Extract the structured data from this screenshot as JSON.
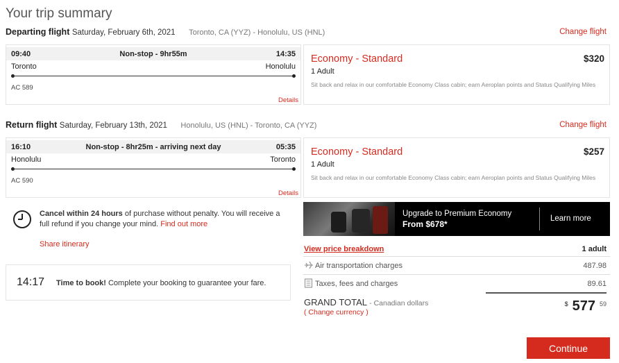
{
  "page": {
    "title": "Your trip summary"
  },
  "departing": {
    "label": "Departing flight",
    "date": "Saturday, February 6th, 2021",
    "route": "Toronto, CA (YYZ) - Honolulu, US (HNL)",
    "change_link": "Change flight",
    "dep_time": "09:40",
    "stops": "Non-stop - 9hr55m",
    "arr_time": "14:35",
    "origin": "Toronto",
    "destination": "Honolulu",
    "flight_number": "AC 589",
    "details_link": "Details",
    "fare": {
      "name": "Economy - Standard",
      "price": "$320",
      "passengers": "1 Adult",
      "description": "Sit back and relax in our comfortable Economy Class cabin; earn Aeroplan points and Status Qualifying Miles"
    }
  },
  "return": {
    "label": "Return flight",
    "date": "Saturday, February 13th, 2021",
    "route": "Honolulu, US (HNL) - Toronto, CA (YYZ)",
    "change_link": "Change flight",
    "dep_time": "16:10",
    "stops": "Non-stop - 8hr25m - arriving next day",
    "arr_time": "05:35",
    "origin": "Honolulu",
    "destination": "Toronto",
    "flight_number": "AC 590",
    "details_link": "Details",
    "fare": {
      "name": "Economy - Standard",
      "price": "$257",
      "passengers": "1 Adult",
      "description": "Sit back and relax in our comfortable Economy Class cabin; earn Aeroplan points and Status Qualifying Miles"
    }
  },
  "cancel_policy": {
    "bold": "Cancel within 24 hours",
    "text": " of purchase without penalty. You will receive a full refund if you change your mind. ",
    "link": "Find out more",
    "icon": "clock-icon"
  },
  "share": {
    "label": "Share itinerary"
  },
  "timer": {
    "time": "14:17",
    "bold": "Time to book!",
    "text": " Complete your booking to guarantee your fare."
  },
  "upsell": {
    "title": "Upgrade to Premium Economy",
    "price_text": "From $678*",
    "cta": "Learn more"
  },
  "breakdown": {
    "link": "View price breakdown",
    "pax": "1 adult",
    "rows": [
      {
        "icon": "plane-icon",
        "label": "Air transportation charges",
        "amount": "487.98"
      },
      {
        "icon": "receipt-icon",
        "label": "Taxes, fees and charges",
        "amount": "89.61"
      }
    ],
    "grand_total_label": "GRAND TOTAL",
    "currency_label": "- Canadian dollars",
    "change_currency_open": "( ",
    "change_currency": "Change currency",
    "change_currency_close": " )",
    "currency_symbol": "$",
    "total_whole": "577",
    "total_cents": "59"
  },
  "continue": {
    "label": "Continue"
  },
  "colors": {
    "accent": "#d52b1e",
    "upsell_bg": "#000000",
    "strip_bg": "#f1f1f1"
  }
}
